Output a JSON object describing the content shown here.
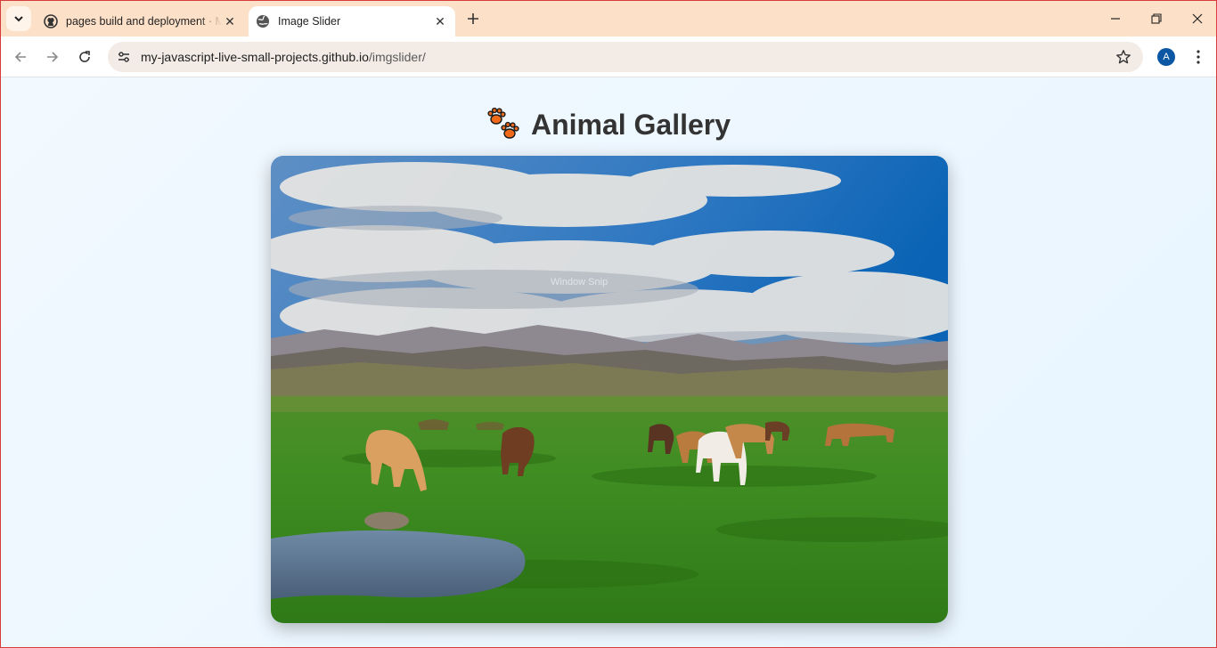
{
  "browser": {
    "tabs": [
      {
        "title": "pages build and deployment · M",
        "favicon": "github-icon",
        "active": false
      },
      {
        "title": "Image Slider",
        "favicon": "globe-icon",
        "active": true
      }
    ],
    "address_bar": {
      "url_host": "my-javascript-live-small-projects.github.io",
      "url_path": "/imgslider/"
    },
    "profile_initial": "A",
    "accent_color": "#fde0c8"
  },
  "page": {
    "title": "Animal Gallery",
    "title_icon": "paw-prints-icon",
    "title_color": "#333333",
    "slide": {
      "subject": "Horses grazing in a green mountain valley",
      "overlay_text": "Window Snip"
    }
  }
}
